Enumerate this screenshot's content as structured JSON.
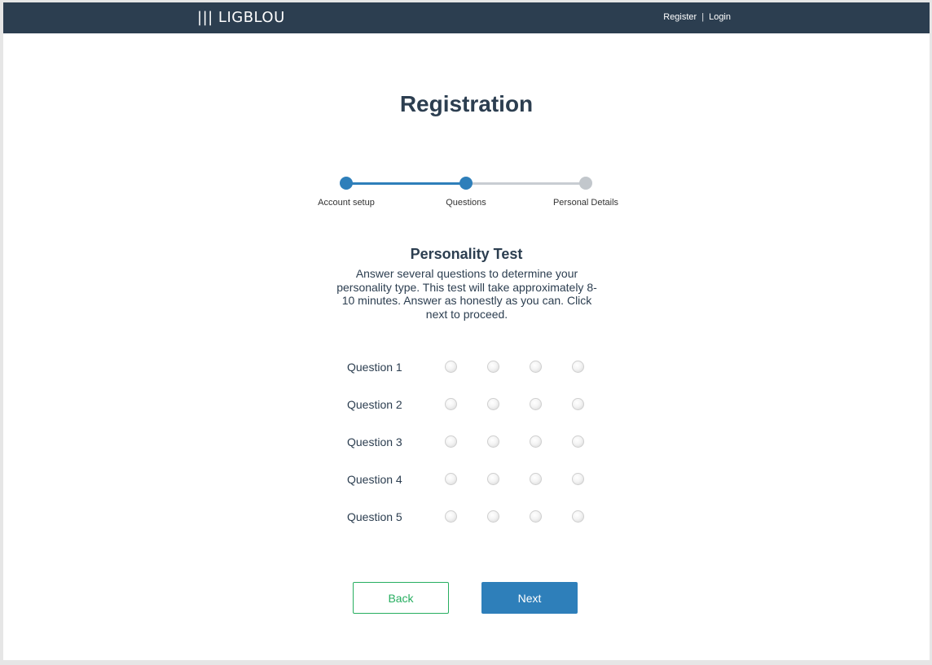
{
  "header": {
    "logo": "||| LIGBLOU",
    "register": "Register",
    "separator": "|",
    "login": "Login"
  },
  "page": {
    "title": "Registration"
  },
  "stepper": {
    "steps": [
      {
        "label": "Account setup",
        "state": "completed"
      },
      {
        "label": "Questions",
        "state": "current"
      },
      {
        "label": "Personal Details",
        "state": "upcoming"
      }
    ]
  },
  "test": {
    "title": "Personality Test",
    "description": "Answer several questions to determine your personality type. This test will take approximately 8-10 minutes. Answer as honestly as you can. Click next to proceed.",
    "questions": [
      {
        "label": "Question 1"
      },
      {
        "label": "Question 2"
      },
      {
        "label": "Question 3"
      },
      {
        "label": "Question 4"
      },
      {
        "label": "Question 5"
      }
    ],
    "options_per_question": 4
  },
  "actions": {
    "back": "Back",
    "next": "Next"
  },
  "colors": {
    "header_bg": "#2c3e50",
    "primary": "#2e7fba",
    "back_outline": "#27ae60",
    "inactive_step": "#c2c7cc"
  }
}
